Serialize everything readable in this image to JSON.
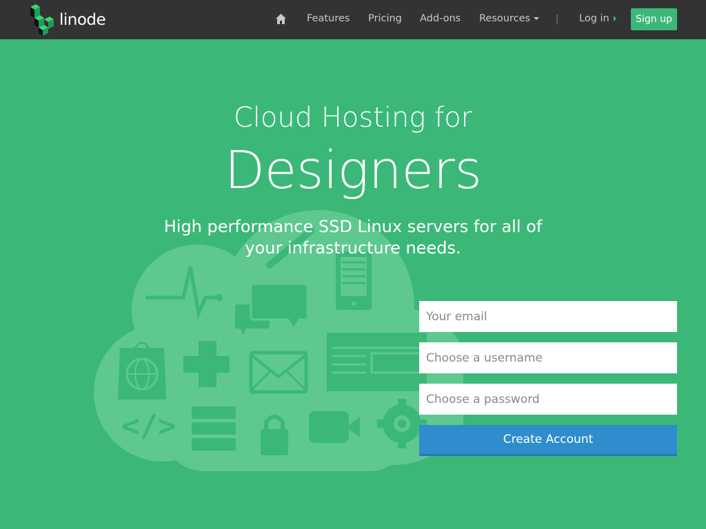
{
  "nav": {
    "brand": "linode",
    "links": {
      "features": "Features",
      "pricing": "Pricing",
      "addons": "Add-ons",
      "resources": "Resources",
      "login": "Log in"
    },
    "divider": "|",
    "signup": "Sign up",
    "icons": {
      "home": "home-icon",
      "resources_caret": "caret-down-icon",
      "login_arrow": "arrow-right-icon"
    }
  },
  "hero": {
    "line1": "Cloud Hosting for",
    "line2": "Designers",
    "subtitle": "High performance SSD Linux servers for all of your infrastructure needs."
  },
  "form": {
    "email_placeholder": "Your email",
    "username_placeholder": "Choose a username",
    "password_placeholder": "Choose a password",
    "submit": "Create Account"
  },
  "colors": {
    "background": "#3bb878",
    "navbar": "#333333",
    "primary_button": "#2f8dce",
    "signup_button": "#3bb878"
  }
}
